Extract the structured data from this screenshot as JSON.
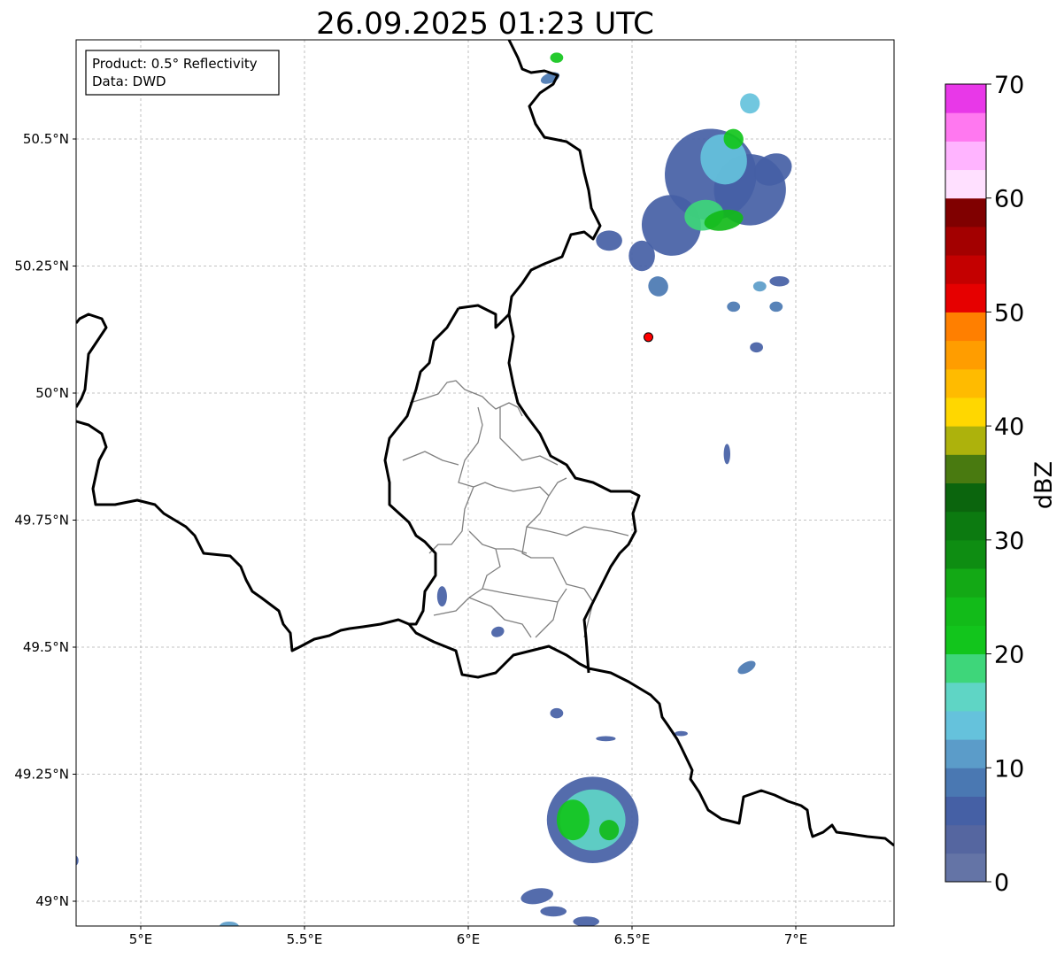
{
  "title": "26.09.2025 01:23 UTC",
  "info_box": {
    "line1": "Product: 0.5° Reflectivity",
    "line2": "Data: DWD"
  },
  "axes": {
    "lon_range": [
      4.8,
      7.3
    ],
    "lat_range": [
      48.95,
      50.7
    ],
    "lon_ticks": [
      {
        "value": 5.0,
        "label": "5°E"
      },
      {
        "value": 5.5,
        "label": "5.5°E"
      },
      {
        "value": 6.0,
        "label": "6°E"
      },
      {
        "value": 6.5,
        "label": "6.5°E"
      },
      {
        "value": 7.0,
        "label": "7°E"
      }
    ],
    "lat_ticks": [
      {
        "value": 49.0,
        "label": "49°N"
      },
      {
        "value": 49.25,
        "label": "49.25°N"
      },
      {
        "value": 49.5,
        "label": "49.5°N"
      },
      {
        "value": 49.75,
        "label": "49.75°N"
      },
      {
        "value": 50.0,
        "label": "50°N"
      },
      {
        "value": 50.25,
        "label": "50.25°N"
      },
      {
        "value": 50.5,
        "label": "50.5°N"
      }
    ]
  },
  "colorbar": {
    "label": "dBZ",
    "min": 0,
    "max": 70,
    "ticks": [
      {
        "value": 0,
        "label": "0"
      },
      {
        "value": 10,
        "label": "10"
      },
      {
        "value": 20,
        "label": "20"
      },
      {
        "value": 30,
        "label": "30"
      },
      {
        "value": 40,
        "label": "40"
      },
      {
        "value": 50,
        "label": "50"
      },
      {
        "value": 60,
        "label": "60"
      },
      {
        "value": 70,
        "label": "70"
      }
    ],
    "colors": [
      "#6474a6",
      "#5566a0",
      "#4560a5",
      "#4a78b2",
      "#5b9cc9",
      "#65c2dc",
      "#5fd5c5",
      "#3ed67a",
      "#12c51c",
      "#12bb19",
      "#13a915",
      "#0e8d12",
      "#0c7a10",
      "#0b650d",
      "#497a10",
      "#adb20c",
      "#ffd700",
      "#ffbb00",
      "#ff9d00",
      "#ff7f00",
      "#e60000",
      "#c40000",
      "#a30000",
      "#800000",
      "#ffe0ff",
      "#ffb4ff",
      "#ff78f0",
      "#e838e8"
    ]
  },
  "radar_site": {
    "lon": 6.55,
    "lat": 50.11,
    "color": "#ff0000"
  },
  "map_colors": {
    "border": "#000000",
    "cantons": "#808080",
    "grid": "#b0b0b0"
  },
  "echoes": [
    {
      "lon": 6.74,
      "lat": 50.43,
      "rlon": 0.14,
      "rlat": 0.09,
      "dbz": 6,
      "rot": -20
    },
    {
      "lon": 6.86,
      "lat": 50.4,
      "rlon": 0.11,
      "rlat": 0.07,
      "dbz": 6,
      "rot": -15
    },
    {
      "lon": 6.62,
      "lat": 50.33,
      "rlon": 0.09,
      "rlat": 0.06,
      "dbz": 5,
      "rot": -20
    },
    {
      "lon": 6.78,
      "lat": 50.46,
      "rlon": 0.07,
      "rlat": 0.05,
      "dbz": 13,
      "rot": -20
    },
    {
      "lon": 6.72,
      "lat": 50.35,
      "rlon": 0.06,
      "rlat": 0.03,
      "dbz": 18,
      "rot": -10
    },
    {
      "lon": 6.78,
      "lat": 50.34,
      "rlon": 0.06,
      "rlat": 0.02,
      "dbz": 23,
      "rot": -10
    },
    {
      "lon": 6.81,
      "lat": 50.5,
      "rlon": 0.03,
      "rlat": 0.02,
      "dbz": 22,
      "rot": -30
    },
    {
      "lon": 6.93,
      "lat": 50.44,
      "rlon": 0.06,
      "rlat": 0.03,
      "dbz": 6,
      "rot": -25
    },
    {
      "lon": 6.86,
      "lat": 50.57,
      "rlon": 0.03,
      "rlat": 0.02,
      "dbz": 14,
      "rot": 0
    },
    {
      "lon": 6.53,
      "lat": 50.27,
      "rlon": 0.04,
      "rlat": 0.03,
      "dbz": 5,
      "rot": 0
    },
    {
      "lon": 6.43,
      "lat": 50.3,
      "rlon": 0.04,
      "rlat": 0.02,
      "dbz": 5,
      "rot": 0
    },
    {
      "lon": 6.58,
      "lat": 50.21,
      "rlon": 0.03,
      "rlat": 0.02,
      "dbz": 8,
      "rot": -40
    },
    {
      "lon": 6.95,
      "lat": 50.22,
      "rlon": 0.03,
      "rlat": 0.01,
      "dbz": 6,
      "rot": 0
    },
    {
      "lon": 6.89,
      "lat": 50.21,
      "rlon": 0.02,
      "rlat": 0.01,
      "dbz": 12,
      "rot": 0
    },
    {
      "lon": 6.81,
      "lat": 50.17,
      "rlon": 0.02,
      "rlat": 0.01,
      "dbz": 8,
      "rot": 0
    },
    {
      "lon": 6.94,
      "lat": 50.17,
      "rlon": 0.02,
      "rlat": 0.01,
      "dbz": 8,
      "rot": 0
    },
    {
      "lon": 6.88,
      "lat": 50.09,
      "rlon": 0.02,
      "rlat": 0.01,
      "dbz": 5,
      "rot": 0
    },
    {
      "lon": 6.79,
      "lat": 49.88,
      "rlon": 0.01,
      "rlat": 0.02,
      "dbz": 6,
      "rot": 0
    },
    {
      "lon": 6.25,
      "lat": 50.62,
      "rlon": 0.03,
      "rlat": 0.01,
      "dbz": 8,
      "rot": -20
    },
    {
      "lon": 6.27,
      "lat": 50.66,
      "rlon": 0.02,
      "rlat": 0.01,
      "dbz": 20,
      "rot": 0
    },
    {
      "lon": 6.38,
      "lat": 49.16,
      "rlon": 0.14,
      "rlat": 0.085,
      "dbz": 6,
      "rot": 0
    },
    {
      "lon": 6.38,
      "lat": 49.16,
      "rlon": 0.1,
      "rlat": 0.06,
      "dbz": 15,
      "rot": 0
    },
    {
      "lon": 6.32,
      "lat": 49.16,
      "rlon": 0.05,
      "rlat": 0.04,
      "dbz": 22,
      "rot": 0
    },
    {
      "lon": 6.43,
      "lat": 49.14,
      "rlon": 0.03,
      "rlat": 0.02,
      "dbz": 24,
      "rot": 0
    },
    {
      "lon": 6.21,
      "lat": 49.01,
      "rlon": 0.05,
      "rlat": 0.015,
      "dbz": 6,
      "rot": -10
    },
    {
      "lon": 6.26,
      "lat": 48.98,
      "rlon": 0.04,
      "rlat": 0.01,
      "dbz": 5,
      "rot": 0
    },
    {
      "lon": 6.36,
      "lat": 48.96,
      "rlon": 0.04,
      "rlat": 0.01,
      "dbz": 6,
      "rot": 0
    },
    {
      "lon": 6.27,
      "lat": 49.37,
      "rlon": 0.02,
      "rlat": 0.01,
      "dbz": 6,
      "rot": 0
    },
    {
      "lon": 6.42,
      "lat": 49.32,
      "rlon": 0.03,
      "rlat": 0.005,
      "dbz": 5,
      "rot": 0
    },
    {
      "lon": 6.85,
      "lat": 49.46,
      "rlon": 0.03,
      "rlat": 0.01,
      "dbz": 8,
      "rot": -30
    },
    {
      "lon": 6.65,
      "lat": 49.33,
      "rlon": 0.02,
      "rlat": 0.005,
      "dbz": 6,
      "rot": 0
    },
    {
      "lon": 5.92,
      "lat": 49.6,
      "rlon": 0.015,
      "rlat": 0.02,
      "dbz": 6,
      "rot": 0
    },
    {
      "lon": 6.09,
      "lat": 49.53,
      "rlon": 0.02,
      "rlat": 0.01,
      "dbz": 6,
      "rot": -20
    },
    {
      "lon": 5.27,
      "lat": 48.95,
      "rlon": 0.03,
      "rlat": 0.01,
      "dbz": 12,
      "rot": 0
    },
    {
      "lon": 4.8,
      "lat": 49.08,
      "rlon": 0.01,
      "rlat": 0.01,
      "dbz": 5,
      "rot": 0
    }
  ]
}
